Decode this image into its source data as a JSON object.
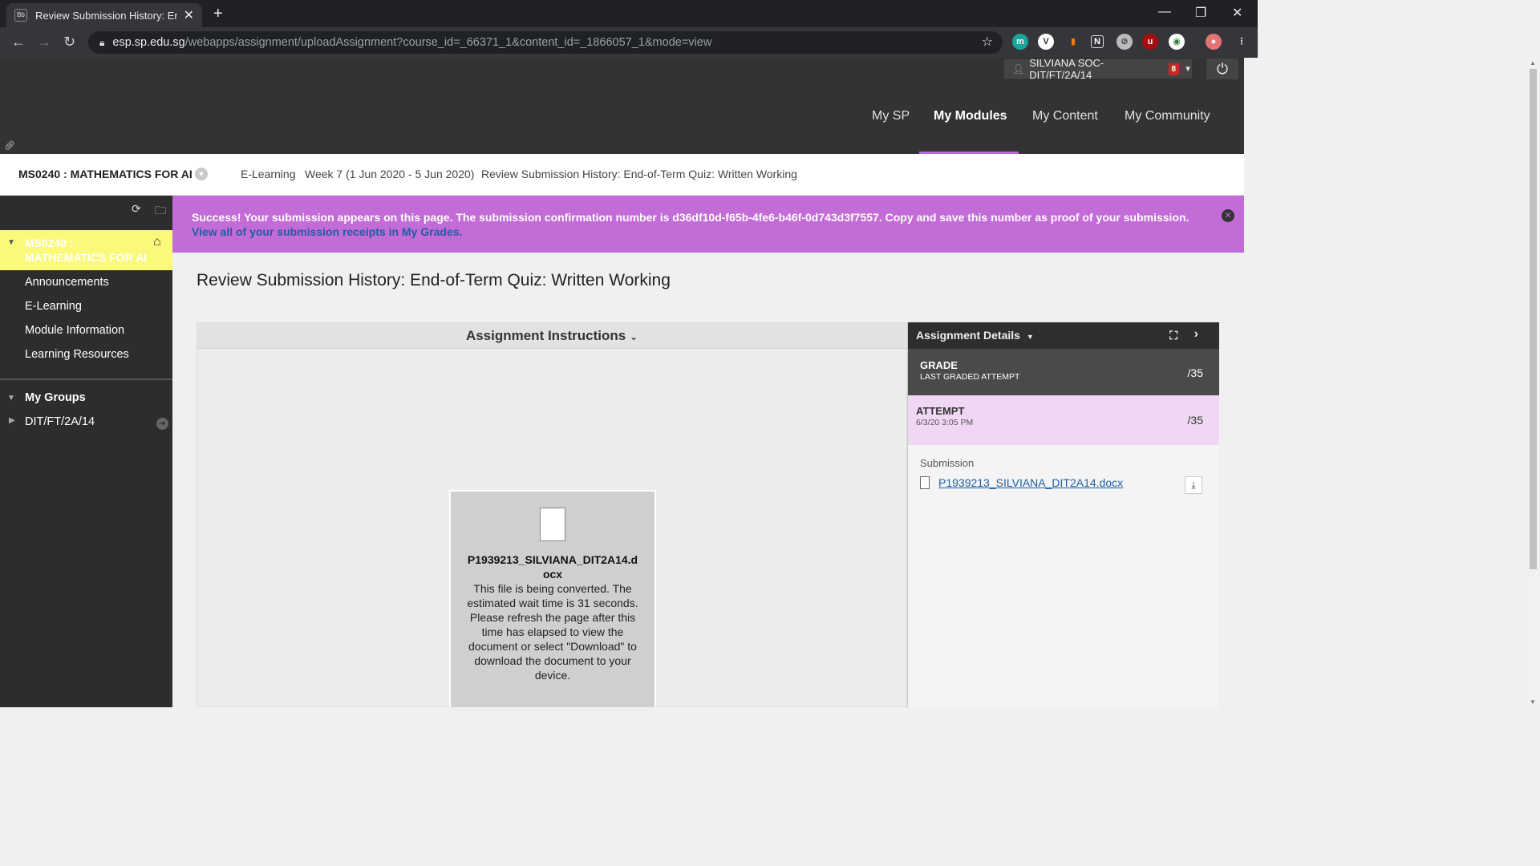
{
  "browser": {
    "tab_title": "Review Submission History: End-",
    "tab_favicon": "Bb",
    "url_host": "esp.sp.edu.sg",
    "url_path": "/webapps/assignment/uploadAssignment?course_id=_66371_1&content_id=_1866057_1&mode=view"
  },
  "header": {
    "user": "SILVIANA SOC-DIT/FT/2A/14",
    "notification_count": "8",
    "nav": [
      {
        "label": "My SP",
        "active": false
      },
      {
        "label": "My Modules",
        "active": true
      },
      {
        "label": "My Content",
        "active": false
      },
      {
        "label": "My Community",
        "active": false
      }
    ]
  },
  "breadcrumb": {
    "course": "MS0240 : MATHEMATICS FOR AI",
    "items": [
      "E-Learning",
      "Week 7 (1 Jun 2020 - 5 Jun 2020)",
      "Review Submission History: End-of-Term Quiz: Written Working"
    ]
  },
  "sidebar": {
    "course_name": "MS0240 : MATHEMATICS FOR AI",
    "items": [
      "Announcements",
      "E-Learning",
      "Module Information",
      "Learning Resources"
    ],
    "groups_header": "My Groups",
    "groups": [
      "DIT/FT/2A/14"
    ]
  },
  "success": {
    "message": "Success! Your submission appears on this page. The submission confirmation number is d36df10d-f65b-4fe6-b46f-0d743d3f7557. Copy and save this number as proof of your submission.",
    "link": "View all of your submission receipts in My Grades."
  },
  "main": {
    "title": "Review Submission History: End-of-Term Quiz: Written Working",
    "instructions_header": "Assignment Instructions",
    "file_name": "P1939213_SILVIANA_DIT2A14.docx",
    "file_message": "This file is being converted. The estimated wait time is 31 seconds. Please refresh the page after this time has elapsed to view the document or select \"Download\" to download the document to your device."
  },
  "details": {
    "header": "Assignment Details",
    "grade_label": "GRADE",
    "grade_sub": "LAST GRADED ATTEMPT",
    "grade_points": "/35",
    "attempt_label": "ATTEMPT",
    "attempt_date": "6/3/20 3:05 PM",
    "attempt_points": "/35",
    "submission_label": "Submission",
    "submission_file": "P1939213_SILVIANA_DIT2A14.docx"
  },
  "colors": {
    "accent": "#c36bd6",
    "course_highlight": "#fbf97a",
    "link": "#1d5fa3"
  }
}
